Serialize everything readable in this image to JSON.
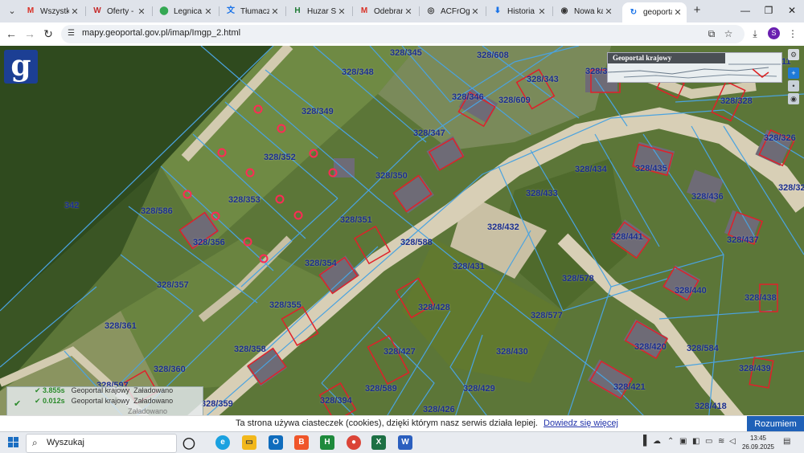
{
  "browser": {
    "tabs": [
      {
        "label": "Wszystkie",
        "icon": "gmail-icon",
        "active": false
      },
      {
        "label": "Oferty - W",
        "icon": "otodom-icon",
        "active": false
      },
      {
        "label": "Legnica, M",
        "icon": "maps-pin-icon",
        "active": false
      },
      {
        "label": "Tłumacz G",
        "icon": "translate-icon",
        "active": false
      },
      {
        "label": "Huzar Soft",
        "icon": "huzar-icon",
        "active": false
      },
      {
        "label": "Odebrane",
        "icon": "gmail-icon",
        "active": false
      },
      {
        "label": "ACFrOgC4",
        "icon": "web-icon",
        "active": false
      },
      {
        "label": "Historia p",
        "icon": "download-icon",
        "active": false
      },
      {
        "label": "Nowa kart",
        "icon": "new-tab-icon",
        "active": false
      },
      {
        "label": "geoportal",
        "icon": "geoportal-icon",
        "active": true
      }
    ],
    "url": "mapy.geoportal.gov.pl/imap/Imgp_2.html",
    "profile_initial": "S"
  },
  "map": {
    "overview_title": "Geoportal krajowy",
    "logo_letter": "g",
    "parcels": [
      {
        "label": "328/345"
      },
      {
        "label": "328/608"
      },
      {
        "label": "328/348"
      },
      {
        "label": "328/343"
      },
      {
        "label": "328/3"
      },
      {
        "label": "328/349"
      },
      {
        "label": "328/346"
      },
      {
        "label": "328/609"
      },
      {
        "label": "328/328"
      },
      {
        "label": "328/347"
      },
      {
        "label": "328/352"
      },
      {
        "label": "328/326"
      },
      {
        "label": "328/350"
      },
      {
        "label": "328/434"
      },
      {
        "label": "328/435"
      },
      {
        "label": "328/433"
      },
      {
        "label": "328/436"
      },
      {
        "label": "328/32"
      },
      {
        "label": "342"
      },
      {
        "label": "328/586"
      },
      {
        "label": "328/353"
      },
      {
        "label": "328/351"
      },
      {
        "label": "328/432"
      },
      {
        "label": "328/441"
      },
      {
        "label": "328/437"
      },
      {
        "label": "328/356"
      },
      {
        "label": "328/588"
      },
      {
        "label": "328/354"
      },
      {
        "label": "328/431"
      },
      {
        "label": "328/578"
      },
      {
        "label": "328/357"
      },
      {
        "label": "328/440"
      },
      {
        "label": "328/355"
      },
      {
        "label": "328/428"
      },
      {
        "label": "328/438"
      },
      {
        "label": "328/577"
      },
      {
        "label": "328/361"
      },
      {
        "label": "328/420"
      },
      {
        "label": "328/584"
      },
      {
        "label": "328/358"
      },
      {
        "label": "328/427"
      },
      {
        "label": "328/430"
      },
      {
        "label": "328/360"
      },
      {
        "label": "328/439"
      },
      {
        "label": "328/421"
      },
      {
        "label": "328/589"
      },
      {
        "label": "328/429"
      },
      {
        "label": "328/597"
      },
      {
        "label": "328/394"
      },
      {
        "label": "328/359"
      },
      {
        "label": "328/426"
      },
      {
        "label": "328/418"
      },
      {
        "label": "11"
      }
    ],
    "status": [
      {
        "time": "3.855s",
        "source": "Geoportal krajowy",
        "state": "Załadowano"
      },
      {
        "time": "0.012s",
        "source": "Geoportal krajowy",
        "state": "Załadowano"
      },
      {
        "time": "",
        "source": "",
        "state": "Załadowano"
      }
    ]
  },
  "cookie": {
    "message": "Ta strona używa ciasteczek (cookies), dzięki którym nasz serwis działa lepiej.",
    "link": "Dowiedz się więcej",
    "button": "Rozumiem"
  },
  "taskbar": {
    "search_placeholder": "Wyszukaj",
    "time": "13:45",
    "date": "26.09.2025"
  },
  "colors": {
    "accent": "#1f61b8",
    "parcel_label": "#1b2e8f",
    "boundary": "#4aa3e0",
    "building": "#e0202a"
  }
}
